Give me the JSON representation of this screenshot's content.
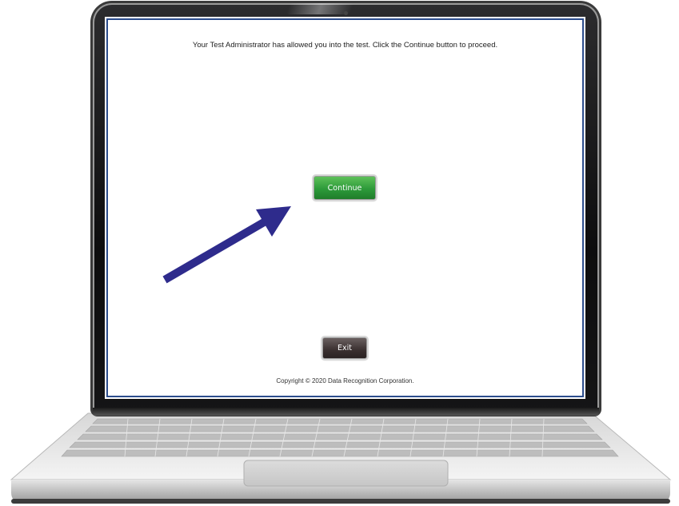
{
  "screen": {
    "message": "Your Test Administrator has allowed you into the test. Click the Continue button to proceed.",
    "continue_label": "Continue",
    "exit_label": "Exit",
    "copyright": "Copyright © 2020 Data Recognition Corporation."
  },
  "colors": {
    "continue_button": "#2d9a3a",
    "exit_button": "#3a3030",
    "screen_border": "#2b4c8c",
    "arrow": "#2e2b8c",
    "laptop_bezel": "#111111"
  },
  "icons": {
    "pointer": "arrow-icon"
  }
}
